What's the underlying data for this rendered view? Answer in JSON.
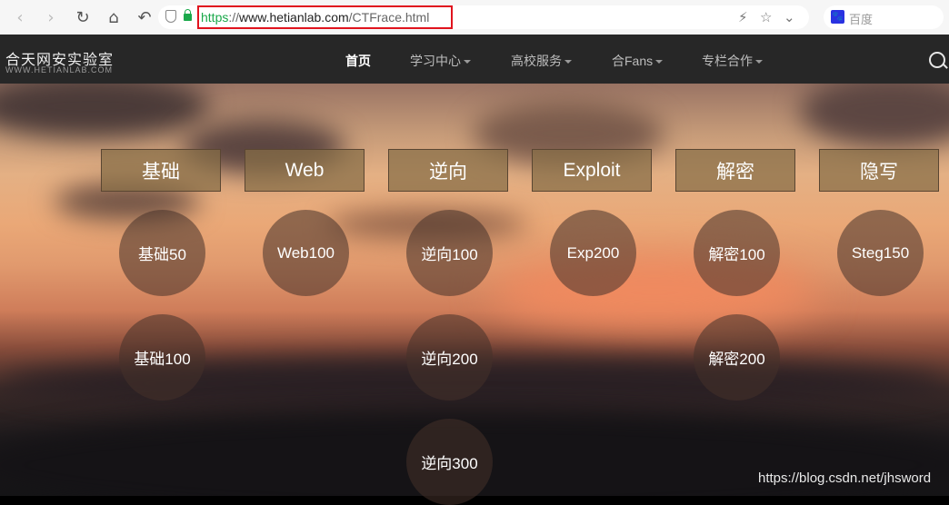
{
  "browser": {
    "url_scheme": "https",
    "url_sep": "://",
    "url_host": "www.hetianlab.com",
    "url_path": "/CTFrace.html",
    "search_engine": "百度"
  },
  "site": {
    "brand_cn": "合天网安实验室",
    "brand_en": "WWW.HETIANLAB.COM",
    "nav": [
      "首页",
      "学习中心",
      "高校服务",
      "合Fans",
      "专栏合作"
    ]
  },
  "categories": [
    {
      "label": "基础",
      "challenges": [
        "基础50",
        "基础100"
      ]
    },
    {
      "label": "Web",
      "challenges": [
        "Web100"
      ]
    },
    {
      "label": "逆向",
      "challenges": [
        "逆向100",
        "逆向200",
        "逆向300"
      ]
    },
    {
      "label": "Exploit",
      "challenges": [
        "Exp200"
      ]
    },
    {
      "label": "解密",
      "challenges": [
        "解密100",
        "解密200"
      ]
    },
    {
      "label": "隐写",
      "challenges": [
        "Steg150"
      ]
    }
  ],
  "watermark": "https://blog.csdn.net/jhsword",
  "colors": {
    "url_highlight": "#e0141e",
    "secure_green": "#1aa84a",
    "nav_bg": "#272727"
  }
}
